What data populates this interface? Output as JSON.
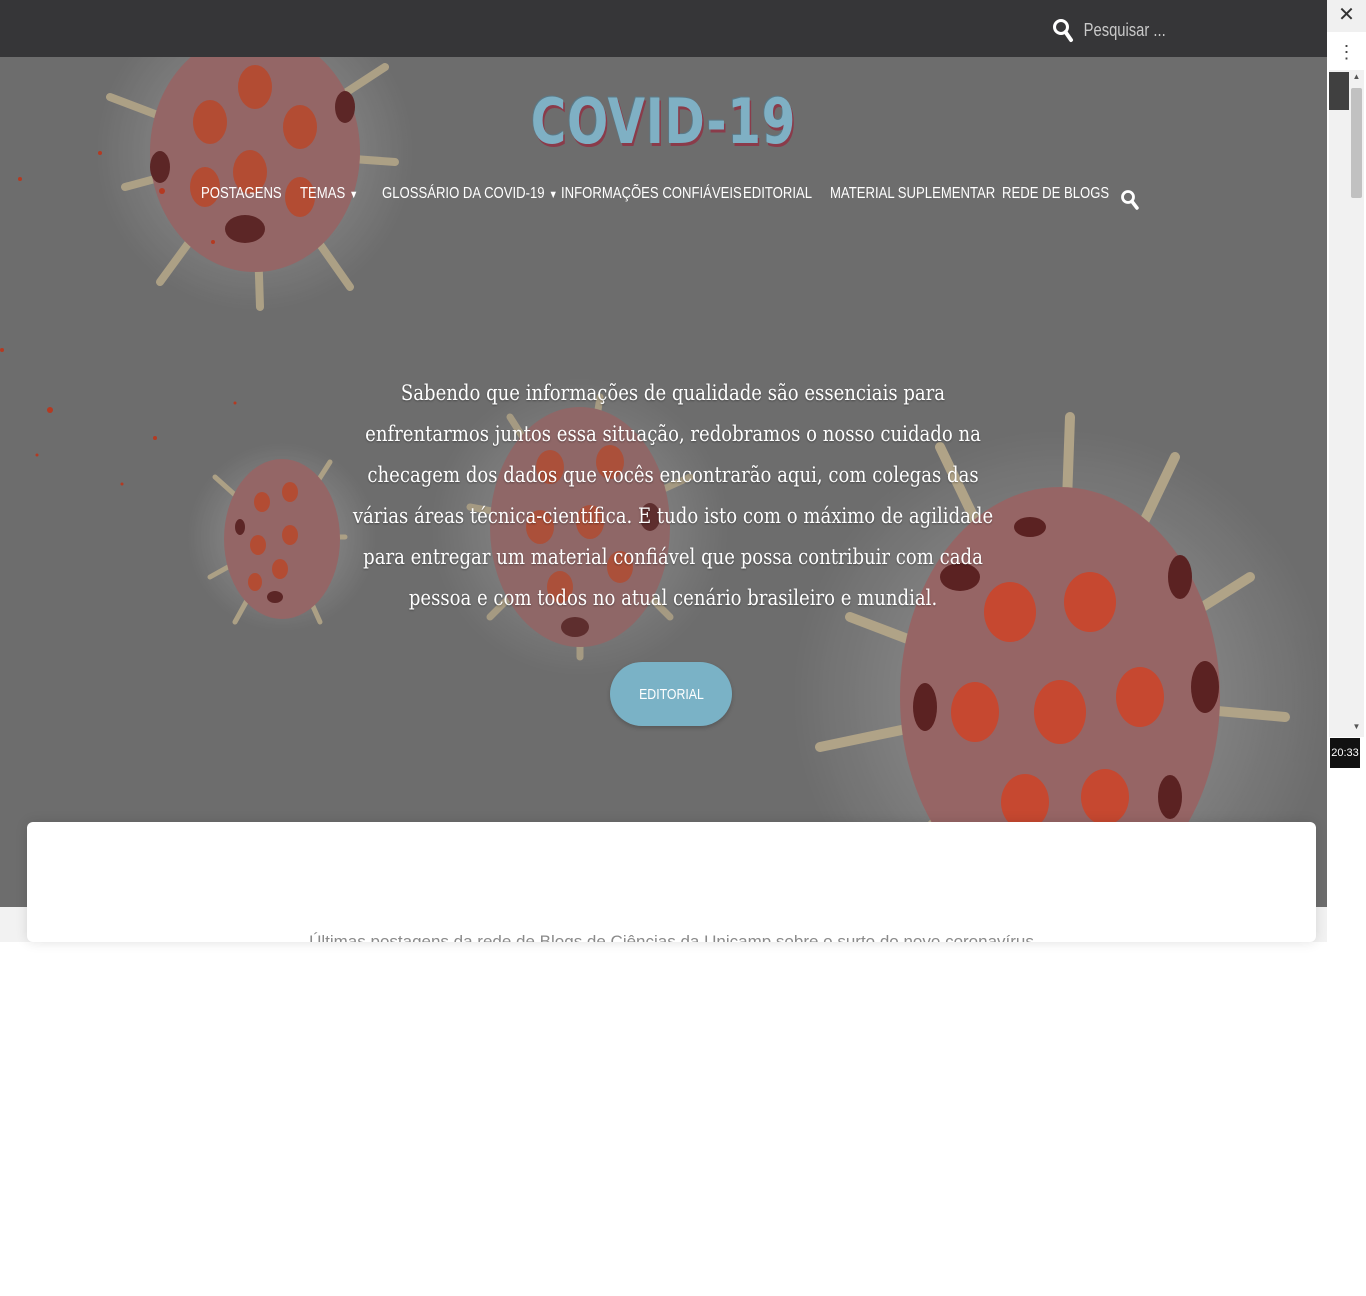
{
  "search": {
    "placeholder": "Pesquisar ..."
  },
  "site": {
    "logo": "COVID-19"
  },
  "nav": {
    "items": [
      {
        "label": "POSTAGENS",
        "has_dropdown": false
      },
      {
        "label": "TEMAS",
        "has_dropdown": true
      },
      {
        "label": "GLOSSÁRIO DA COVID-19",
        "has_dropdown": true
      },
      {
        "label": "INFORMAÇÕES CONFIÁVEIS",
        "has_dropdown": false
      },
      {
        "label": "EDITORIAL",
        "has_dropdown": false
      },
      {
        "label": "MATERIAL SUPLEMENTAR",
        "has_dropdown": false
      },
      {
        "label": "REDE DE BLOGS",
        "has_dropdown": false
      }
    ]
  },
  "hero": {
    "text": "Sabendo que informações de qualidade são essenciais para enfrentarmos juntos essa situação, redobramos o nosso cuidado na checagem dos dados que vocês encontrarão aqui, com colegas das várias áreas técnica-científica. E tudo isto com o máximo de agilidade para entregar um material confiável que possa contribuir com cada pessoa e com todos no atual cenário brasileiro e mundial.",
    "button_label": "EDITORIAL"
  },
  "content": {
    "subtitle": "Últimas postagens da rede de Blogs de Ciências da Unicamp sobre o surto do novo coronavírus"
  },
  "side": {
    "clock": "20:33"
  },
  "colors": {
    "topbar": "#363638",
    "accent": "#7ab2c6",
    "hero_bg": "#6d6d6d"
  }
}
